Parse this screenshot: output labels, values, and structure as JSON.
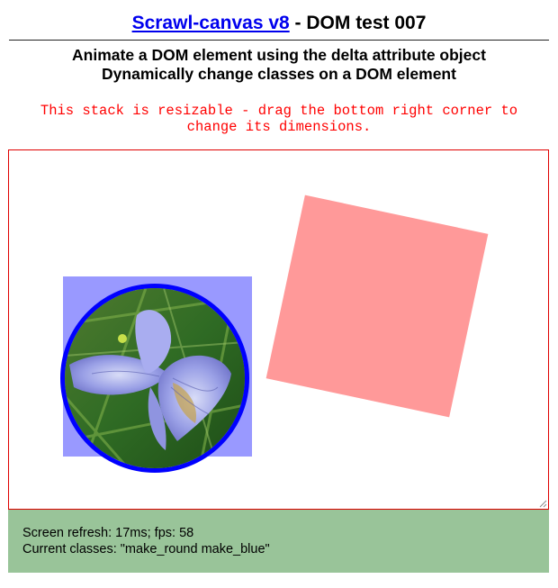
{
  "header": {
    "link_text": "Scrawl-canvas v8",
    "title_rest": " - DOM test 007"
  },
  "subtitle": {
    "line1": "Animate a DOM element using the delta attribute object",
    "line2": "Dynamically change classes on a DOM element"
  },
  "warning": {
    "line1": "This stack is resizable - drag the bottom right corner to",
    "line2": "change its dimensions."
  },
  "report": {
    "refresh": "Screen refresh: 17ms; fps: 58",
    "classes": "Current classes: \"make_round make_blue\""
  },
  "colors": {
    "link": "#0000ee",
    "warning": "#ff0000",
    "stack_border": "#e00000",
    "flower_box": "#9999ff",
    "flower_ring": "#0000ff",
    "pink_square": "#ff9999",
    "report_bg": "#99c499"
  },
  "icons": {
    "resize": "resize-grip-icon"
  }
}
